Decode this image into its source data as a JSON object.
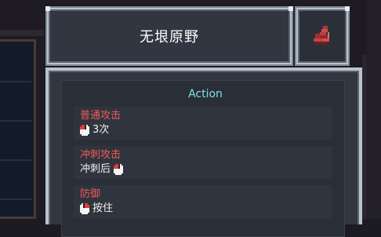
{
  "card": {
    "title": "无垠原野",
    "icon": "red-boots-icon"
  },
  "action": {
    "header": "Action",
    "entries": [
      {
        "title": "普通攻击",
        "desc": "3次",
        "icon": "mouse-left-click-icon",
        "icon_side": "left"
      },
      {
        "title": "冲刺攻击",
        "desc": "冲刺后",
        "icon": "mouse-left-click-icon",
        "icon_side": "right"
      },
      {
        "title": "防御",
        "desc": "按住",
        "icon": "mouse-right-click-icon",
        "icon_side": "left"
      }
    ]
  },
  "colors": {
    "header": "#7ee0e6",
    "entry_title": "#ef5a5a",
    "frame": "#b8c3cc",
    "panel": "#313640"
  }
}
